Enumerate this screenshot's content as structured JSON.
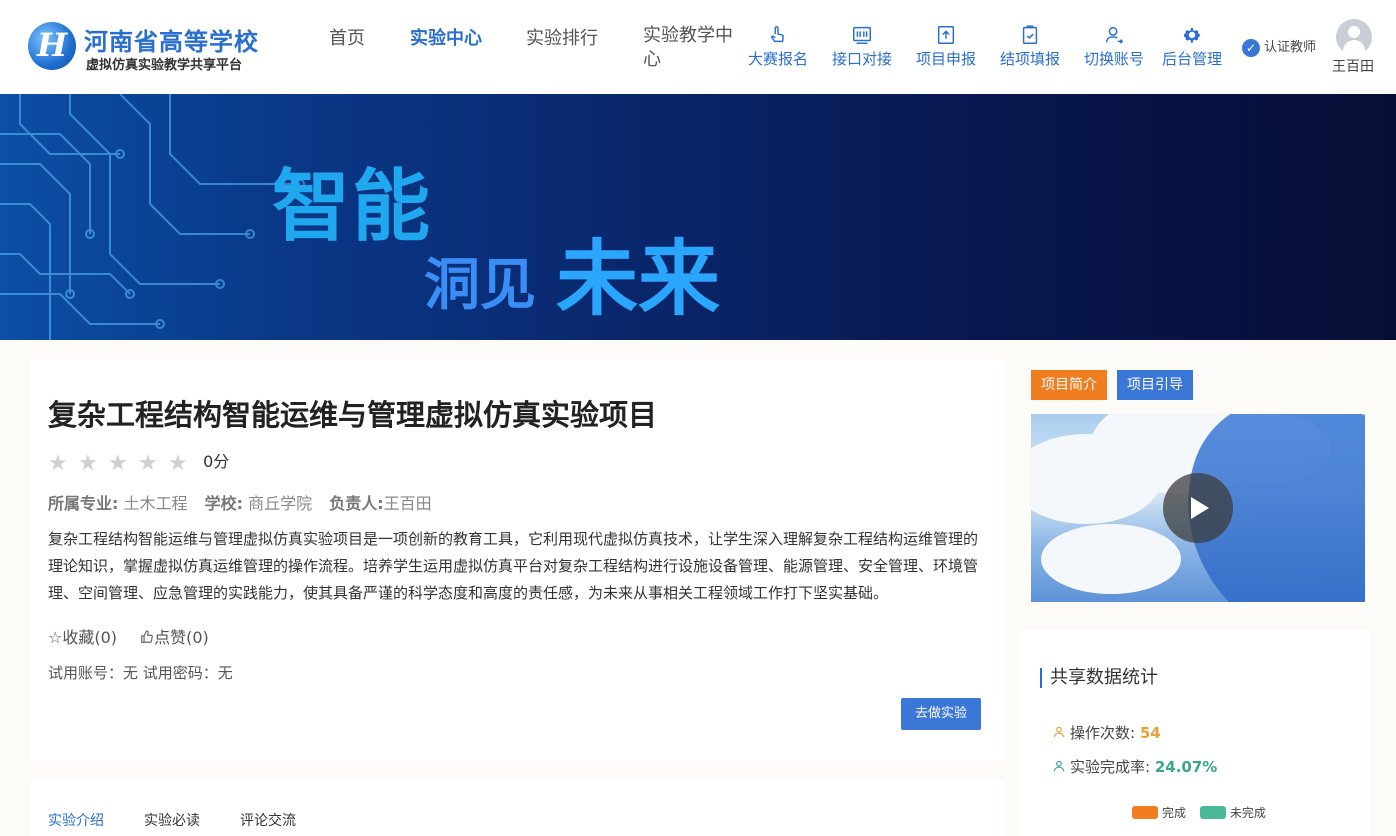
{
  "header": {
    "logo_title": "河南省高等学校",
    "logo_subtitle": "虚拟仿真实验教学共享平台",
    "nav": [
      {
        "label": "首页",
        "active": false
      },
      {
        "label": "实验中心",
        "active": true
      },
      {
        "label": "实验排行",
        "active": false
      },
      {
        "label": "实验教学中心",
        "active": false
      }
    ],
    "tools": [
      {
        "label": "大赛报名",
        "icon": "tap-icon"
      },
      {
        "label": "接口对接",
        "icon": "interface-icon"
      },
      {
        "label": "项目申报",
        "icon": "upload-icon"
      },
      {
        "label": "结项填报",
        "icon": "clipboard-check-icon"
      },
      {
        "label": "切换账号",
        "icon": "switch-user-icon"
      },
      {
        "label": "后台管理",
        "icon": "gear-icon"
      }
    ],
    "cert_label": "认证教师",
    "username": "王百田"
  },
  "banner": {
    "line1": "智能",
    "line2": "洞见",
    "line3": "未来"
  },
  "project": {
    "title": "复杂工程结构智能运维与管理虚拟仿真实验项目",
    "rating": 0,
    "max_rating": 5,
    "score_label": "0分",
    "major_key": "所属专业:",
    "major": "土木工程",
    "school_key": "学校:",
    "school": "商丘学院",
    "owner_key": "负责人:",
    "owner": "王百田",
    "description": "复杂工程结构智能运维与管理虚拟仿真实验项目是一项创新的教育工具，它利用现代虚拟仿真技术，让学生深入理解复杂工程结构运维管理的理论知识，掌握虚拟仿真运维管理的操作流程。培养学生运用虚拟仿真平台对复杂工程结构进行设施设备管理、能源管理、安全管理、环境管理、空间管理、应急管理的实践能力，使其具备严谨的科学态度和高度的责任感，为未来从事相关工程领域工作打下坚实基础。",
    "favorite_label": "☆收藏(0)",
    "like_label": "点赞(0)",
    "trial_text": "试用账号：无 试用密码：无",
    "go_button": "去做实验"
  },
  "tabs": [
    {
      "label": "实验介绍",
      "active": true
    },
    {
      "label": "实验必读",
      "active": false
    },
    {
      "label": "评论交流",
      "active": false
    }
  ],
  "side": {
    "btn_intro": "项目简介",
    "btn_guide": "项目引导",
    "stats_title": "共享数据统计",
    "ops_label": "操作次数:",
    "ops_value": "54",
    "rate_label": "实验完成率:",
    "rate_value": "24.07%",
    "legend_done": "完成",
    "legend_undone": "未完成",
    "color_done": "#f07d1f",
    "color_undone": "#4cb89a"
  }
}
